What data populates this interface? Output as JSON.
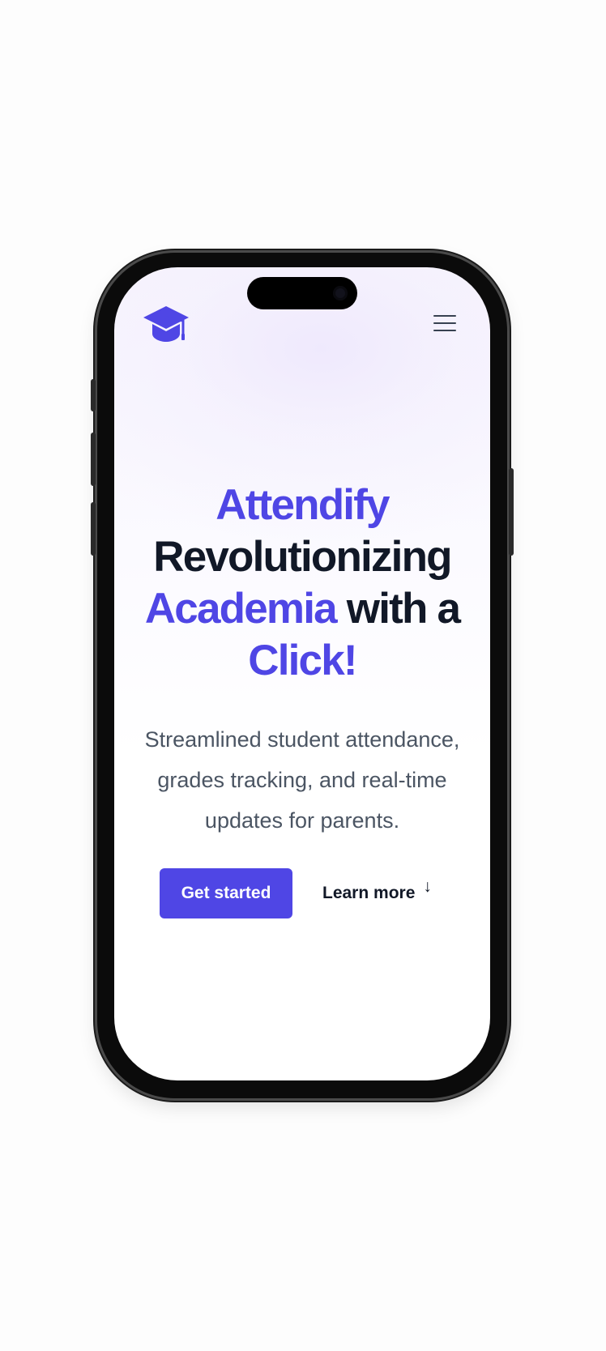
{
  "colors": {
    "accent": "#4f46e5",
    "heading": "#111827",
    "body_text": "#4b5563",
    "background_tint": "#f3effd"
  },
  "header": {
    "logo_icon": "graduation-cap-icon",
    "menu_icon": "hamburger-menu-icon"
  },
  "hero": {
    "title_line1_accent": "Attendify",
    "title_line2": "Revolutionizing",
    "title_line3_accent": "Academia",
    "title_line3_rest": " with a",
    "title_line4_accent": "Click!",
    "subtitle": "Streamlined student attendance, grades tracking, and real-time updates for parents.",
    "primary_button": "Get started",
    "secondary_link": "Learn more",
    "secondary_icon": "arrow-down-icon",
    "secondary_arrow": "↓"
  }
}
